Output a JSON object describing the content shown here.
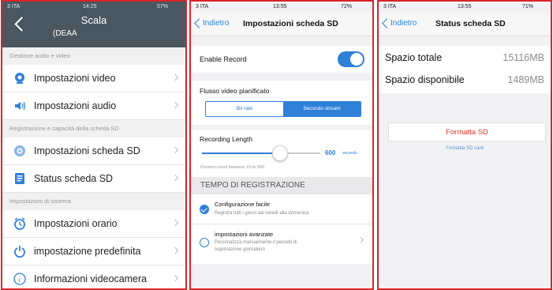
{
  "panel1": {
    "status": {
      "carrier": "3 ITA",
      "time": "14:25",
      "battery": "57%"
    },
    "title": "Scala",
    "subtitle": "(DEAA",
    "sections": [
      {
        "header": "Gestione audio e video",
        "items": [
          {
            "icon": "video-settings-icon",
            "label": "Impostazioni video"
          },
          {
            "icon": "audio-settings-icon",
            "label": "Impostazioni audio"
          }
        ]
      },
      {
        "header": "Registrazione e capacità della scheda SD",
        "items": [
          {
            "icon": "sd-settings-icon",
            "label": "Impostazioni scheda SD"
          },
          {
            "icon": "sd-status-icon",
            "label": "Status scheda SD"
          }
        ]
      },
      {
        "header": "Impostazioni di sistema",
        "items": [
          {
            "icon": "clock-icon",
            "label": "Impostazioni orario"
          },
          {
            "icon": "power-icon",
            "label": "impostazione predefinita"
          },
          {
            "icon": "info-icon",
            "label": "Informazioni videocamera"
          }
        ]
      }
    ]
  },
  "panel2": {
    "status": {
      "carrier": "3 ITA",
      "time": "13:55",
      "battery": "72%"
    },
    "back_label": "Indietro",
    "title": "Impostazioni scheda SD",
    "enable_record": {
      "label": "Enable Record",
      "on": true
    },
    "flusso": {
      "label": "Flusso video pianificato",
      "options": [
        "Bit rate",
        "Secondo stream"
      ],
      "selected": 1
    },
    "recording": {
      "label": "Recording Length",
      "value": "600",
      "unit": "seconds",
      "note": "Duration must between 15 to 900",
      "min": 15,
      "max": 900,
      "current": 600
    },
    "tempo_header": "TEMPO DI REGISTRAZIONE",
    "options": [
      {
        "title": "Configurazione facile",
        "desc": "Registra tutti i giorni dal lunedì alla domenica",
        "selected": true
      },
      {
        "title": "impostazioni avanzate",
        "desc1": "Personalizza manualmente il periodo di",
        "desc2": "registrazione giornaliero",
        "selected": false
      }
    ]
  },
  "panel3": {
    "status": {
      "carrier": "3 ITA",
      "time": "13:55",
      "battery": "71%"
    },
    "back_label": "Indietro",
    "title": "Status scheda SD",
    "stats": [
      {
        "label": "Spazio totale",
        "value": "15116MB"
      },
      {
        "label": "Spazio disponibile",
        "value": "1489MB"
      }
    ],
    "format_button": "Formatta SD",
    "format_sub": "Formatta SD card"
  },
  "colors": {
    "frame": "#d8242a",
    "accent": "#2f80d8",
    "header": "#4a5761",
    "danger": "#e0342c"
  }
}
